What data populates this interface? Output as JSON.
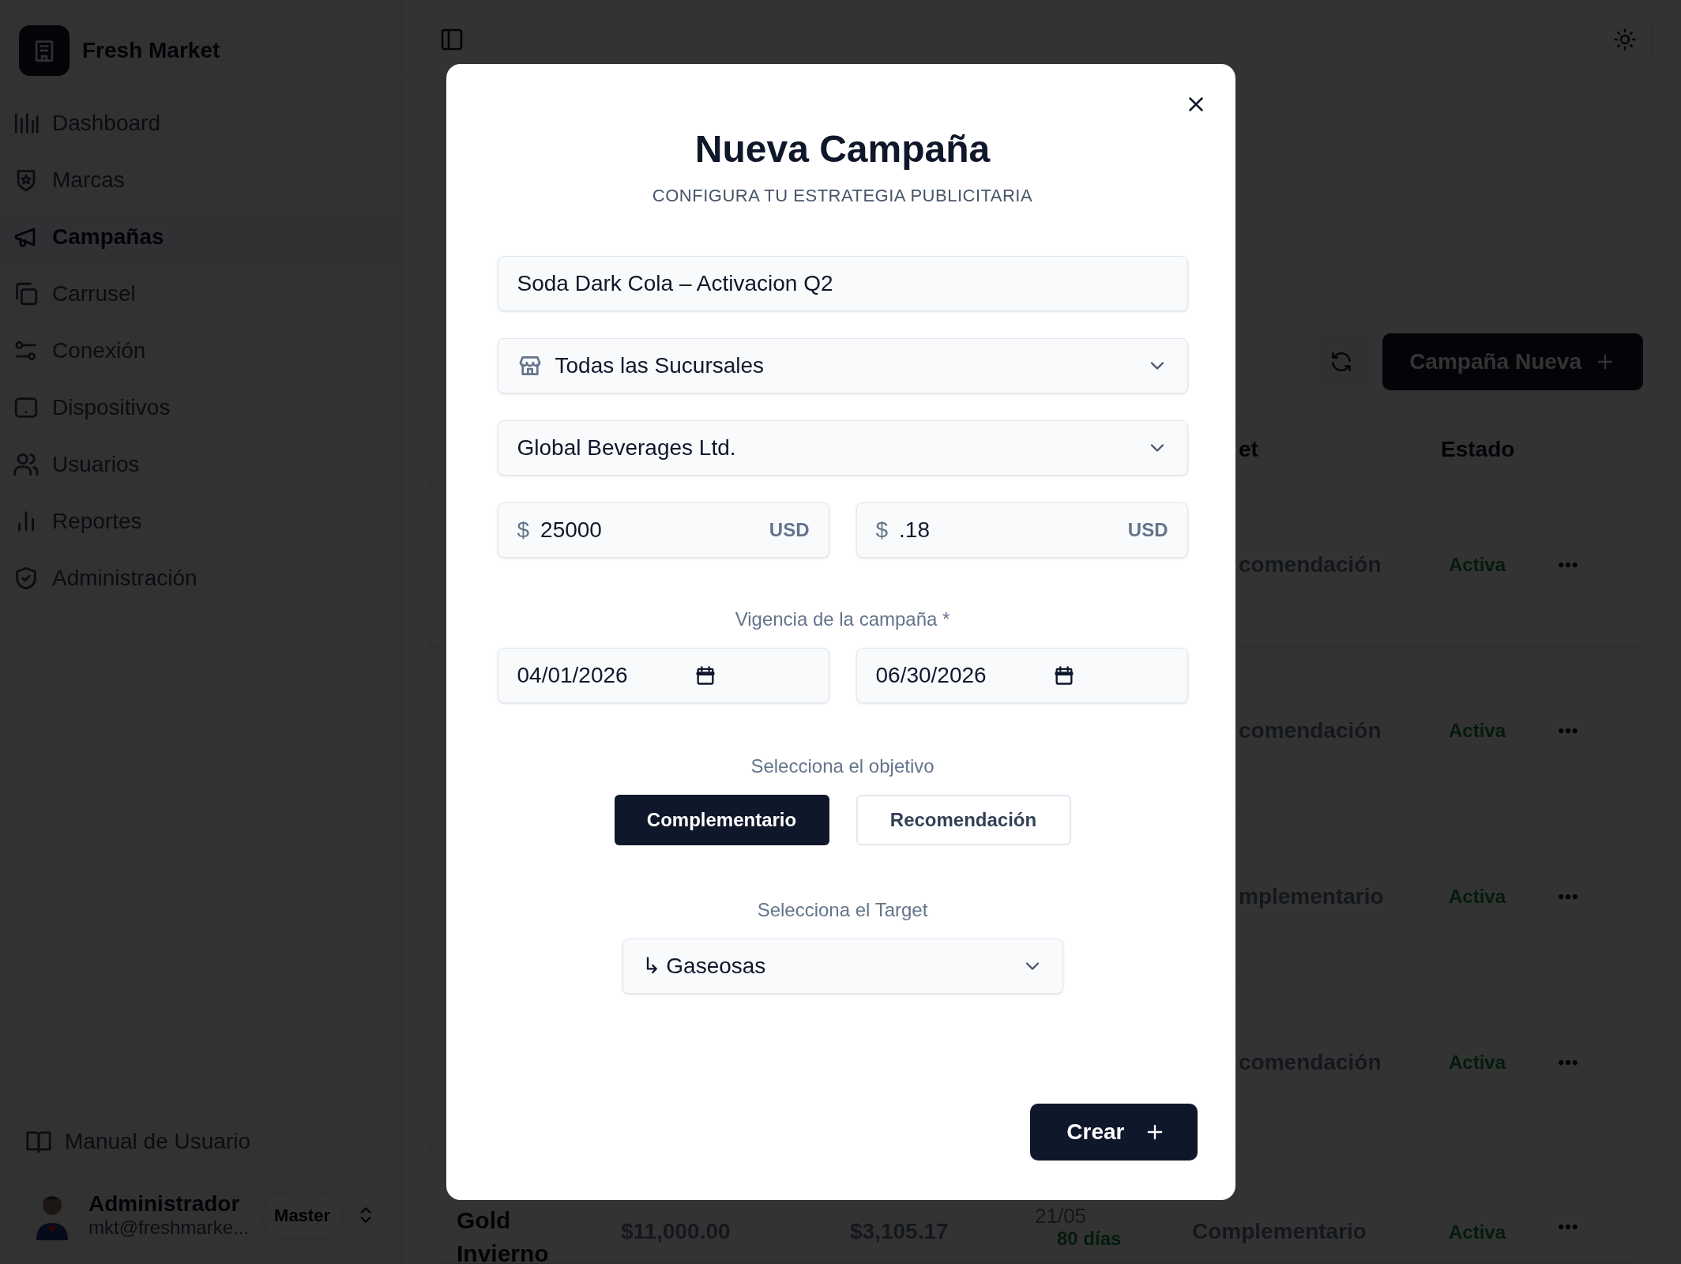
{
  "sidebar": {
    "brand": "Fresh Market",
    "items": [
      {
        "label": "Dashboard",
        "selected": false
      },
      {
        "label": "Marcas",
        "selected": false
      },
      {
        "label": "Campañas",
        "selected": true
      },
      {
        "label": "Carrusel",
        "selected": false
      },
      {
        "label": "Conexión",
        "selected": false
      },
      {
        "label": "Dispositivos",
        "selected": false
      },
      {
        "label": "Usuarios",
        "selected": false
      },
      {
        "label": "Reportes",
        "selected": false
      },
      {
        "label": "Administración",
        "selected": false
      }
    ],
    "manual": "Manual de Usuario",
    "user": {
      "name": "Administrador",
      "email": "mkt@freshmarke...",
      "role": "Master"
    }
  },
  "toolbar": {
    "new_campaign_button": "Campaña Nueva"
  },
  "table": {
    "columns": [
      "et",
      "Estado"
    ],
    "rows": [
      {
        "target": "comendación",
        "status": "Activa"
      },
      {
        "target": "comendación",
        "status": "Activa"
      },
      {
        "target": "mplementario",
        "status": "Activa"
      },
      {
        "target": "comendación",
        "status": "Activa"
      }
    ],
    "last_row": {
      "name": "Gold Invierno",
      "budget": "$11,000.00",
      "spent": "$3,105.17",
      "date": "21/05",
      "remaining": "80 días",
      "target": "Complementario",
      "status": "Activa"
    }
  },
  "modal": {
    "title": "Nueva Campaña",
    "subtitle": "CONFIGURA TU ESTRATEGIA PUBLICITARIA",
    "name_value": "Soda Dark Cola – Activacion Q2",
    "branch_select": "Todas las Sucursales",
    "company_select": "Global Beverages Ltd.",
    "budget": {
      "prefix": "$",
      "value": "25000",
      "suffix": "USD"
    },
    "cost": {
      "prefix": "$",
      "value": ".18",
      "suffix": "USD"
    },
    "period_label": "Vigencia de la campaña *",
    "start_date": "04/01/2026",
    "end_date": "06/30/2026",
    "objective_label": "Selecciona el objetivo",
    "objectives": [
      {
        "label": "Complementario",
        "selected": true
      },
      {
        "label": "Recomendación",
        "selected": false
      }
    ],
    "target_label": "Selecciona el Target",
    "target_select": "↳ Gaseosas",
    "submit": "Crear"
  }
}
